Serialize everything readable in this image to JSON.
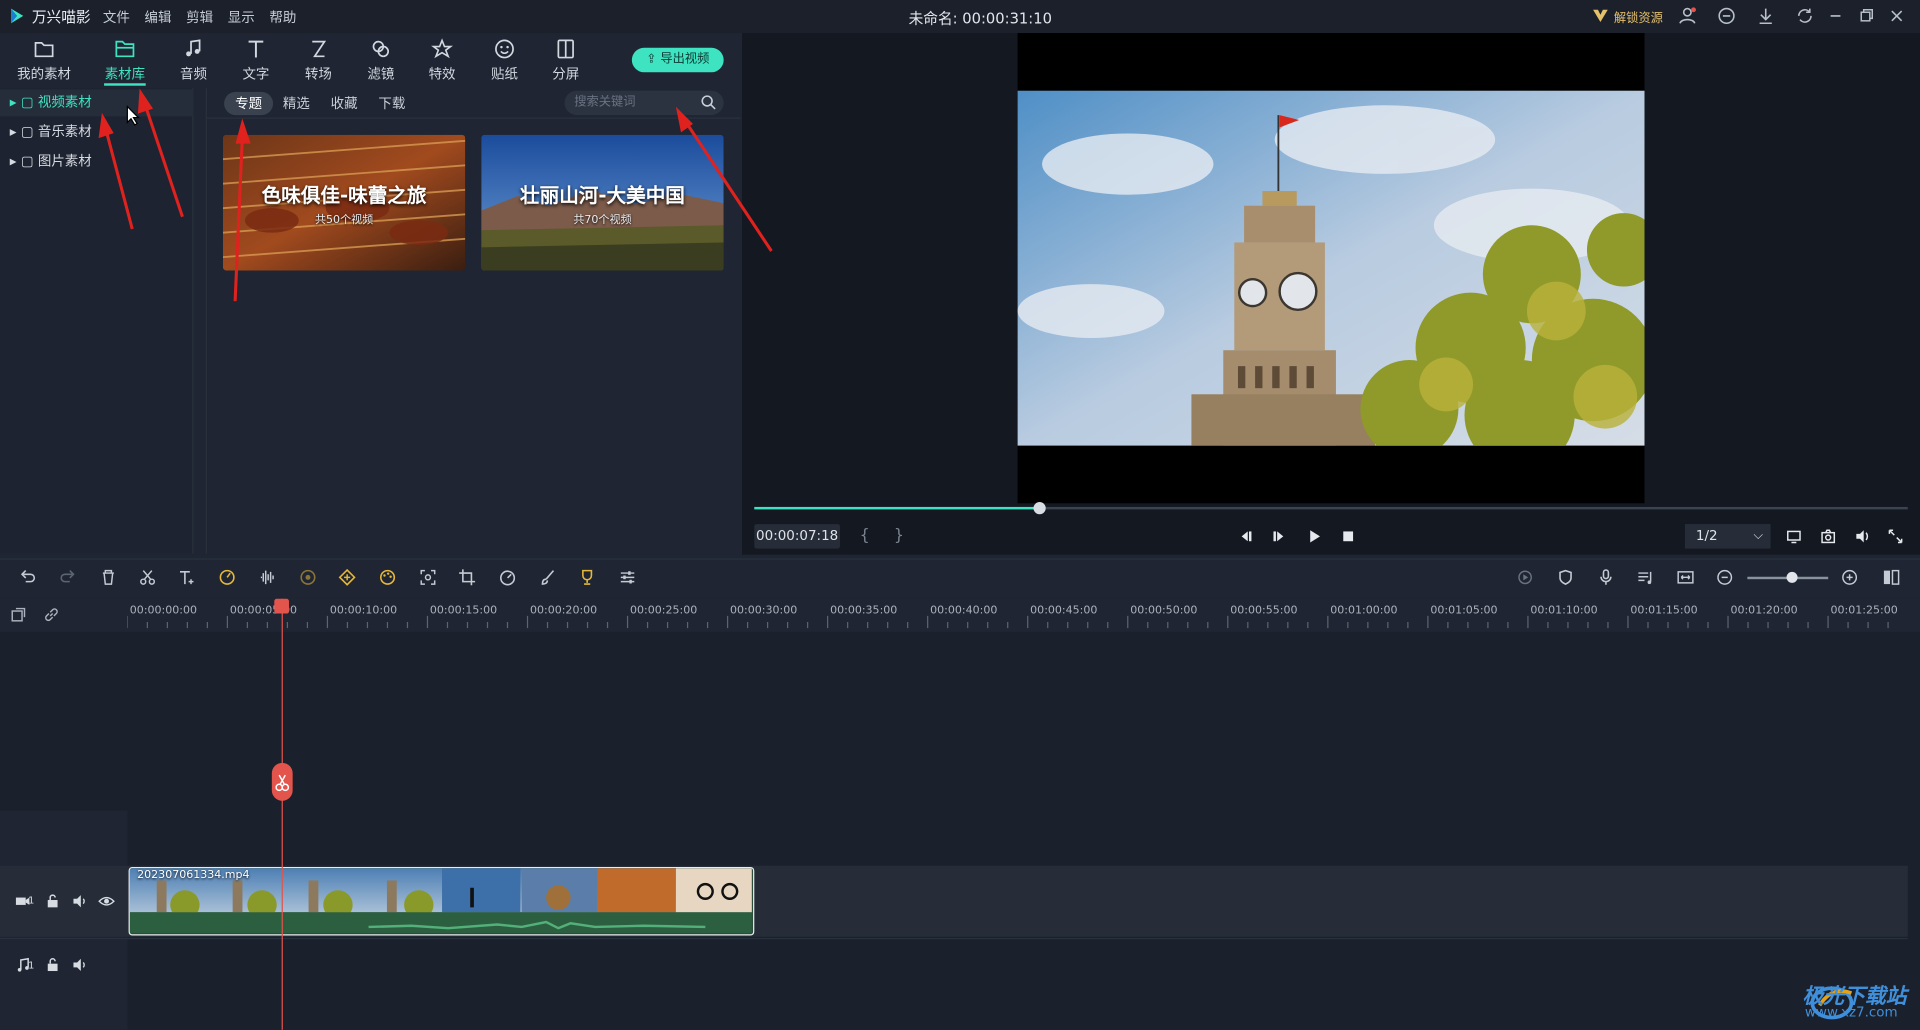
{
  "app": {
    "name": "万兴喵影",
    "document_title": "未命名: 00:00:31:10",
    "unlock_label": "解锁资源"
  },
  "menu": [
    "文件",
    "编辑",
    "剪辑",
    "显示",
    "帮助"
  ],
  "media_tabs": [
    {
      "label": "我的素材",
      "icon": "folder-icon"
    },
    {
      "label": "素材库",
      "icon": "library-folder-icon",
      "active": true
    },
    {
      "label": "音频",
      "icon": "music-note-icon"
    },
    {
      "label": "文字",
      "icon": "text-icon"
    },
    {
      "label": "转场",
      "icon": "transition-icon"
    },
    {
      "label": "滤镜",
      "icon": "filter-icon"
    },
    {
      "label": "特效",
      "icon": "effects-icon"
    },
    {
      "label": "贴纸",
      "icon": "sticker-icon"
    },
    {
      "label": "分屏",
      "icon": "split-screen-icon"
    }
  ],
  "export_label": "导出视频",
  "tree": [
    {
      "label": "视频素材",
      "selected": true
    },
    {
      "label": "音乐素材"
    },
    {
      "label": "图片素材"
    }
  ],
  "library_tabs": [
    {
      "label": "专题",
      "active": true
    },
    {
      "label": "精选"
    },
    {
      "label": "收藏"
    },
    {
      "label": "下载"
    }
  ],
  "search": {
    "placeholder": "搜索关键词"
  },
  "cards": [
    {
      "title": "色味俱佳-味蕾之旅",
      "count": "共50个视频"
    },
    {
      "title": "壮丽山河-大美中国",
      "count": "共70个视频"
    }
  ],
  "player": {
    "timecode": "00:00:07:18",
    "ratio": "1/2",
    "progress": 0.247,
    "mark_in": "{",
    "mark_out": "}"
  },
  "ruler": [
    "00:00:00:00",
    "00:00:05:00",
    "00:00:10:00",
    "00:00:15:00",
    "00:00:20:00",
    "00:00:25:00",
    "00:00:30:00",
    "00:00:35:00",
    "00:00:40:00",
    "00:00:45:00",
    "00:00:50:00",
    "00:00:55:00",
    "00:01:00:00",
    "00:01:05:00",
    "00:01:10:00",
    "00:01:15:00",
    "00:01:20:00",
    "00:01:25:00"
  ],
  "clip": {
    "name": "202307061334.mp4"
  },
  "tracks": {
    "video_index": "1",
    "audio_index": "1"
  },
  "zoom": {
    "level": 0.55
  },
  "watermark": {
    "text": "极光下载站",
    "url": "www.xz7.com"
  },
  "colors": {
    "accent": "#3ee3c1",
    "playhead": "#e2544c",
    "annotation": "#e0221f"
  }
}
